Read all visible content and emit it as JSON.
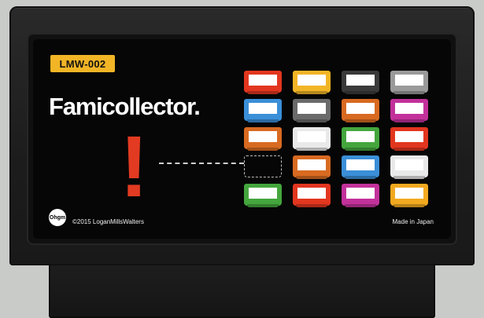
{
  "label": {
    "code": "LMW-002",
    "brand": "Famicollector.",
    "exclamation": "!",
    "copyright": "©2015 LoganMillsWalters",
    "made_in": "Made in Japan",
    "logo_text": "Ohgm"
  },
  "colors": {
    "cartridge": "#1e1e1e",
    "label_bg": "#060606",
    "badge": "#f2b526",
    "exclamation": "#e23b22"
  },
  "cartridge_grid": [
    [
      "#e2361f",
      "#f2b526",
      "#3a3a3a",
      "#9a9a9a"
    ],
    [
      "#3a8fd8",
      "#6a6a6a",
      "#d86a21",
      "#c2319a"
    ],
    [
      "#d86a21",
      "#e9e9e9",
      "#44a63d",
      "#e2361f"
    ],
    [
      "empty",
      "#d86a21",
      "#3a8fd8",
      "#e9e9e9"
    ],
    [
      "#44a63d",
      "#e2361f",
      "#c2319a",
      "#f2a91f"
    ]
  ]
}
